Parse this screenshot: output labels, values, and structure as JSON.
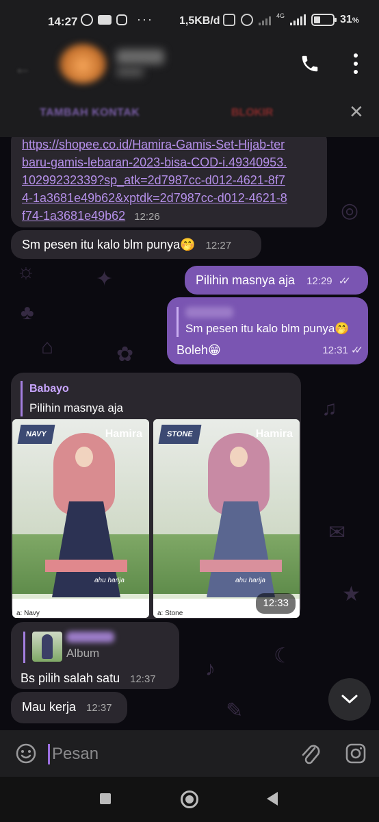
{
  "status_bar": {
    "time": "14:27",
    "more": "···",
    "net_speed": "1,5KB/d",
    "network": "4G",
    "battery": "31",
    "battery_unit": "%"
  },
  "header": {
    "add_contact": "TAMBAH KONTAK",
    "block": "BLOKIR",
    "icons": [
      "back-arrow-icon",
      "phone-icon",
      "more-vert-icon",
      "close-icon"
    ]
  },
  "messages": {
    "m1": {
      "text": "https://shopee.co.id/Hamira-Gamis-Set-Hijab-terbaru-gamis-lebaran-2023-bisa-COD-i.49340953.10299232339?sp_atk=2d7987cc-d012-4621-8f74-1a3681e49b62&xptdk=2d7987cc-d012-4621-8f74-1a3681e49b62",
      "time": "12:26"
    },
    "m2": {
      "text": "Sm pesen itu kalo blm punya🤭",
      "time": "12:27"
    },
    "m3": {
      "text": "Pilihin masnya aja",
      "time": "12:29"
    },
    "m4": {
      "quote": "Sm pesen itu kalo blm punya🤭",
      "text": "Boleh😁",
      "time": "12:31"
    },
    "m5": {
      "reply_name": "Babayo",
      "reply_text": "Pilihin masnya aja",
      "photos": [
        {
          "tag": "NAVY",
          "brand": "Hamira",
          "caption": "a: Navy",
          "watermark": "ahu harija"
        },
        {
          "tag": "STONE",
          "brand": "Hamira",
          "caption": "a: Stone",
          "watermark": "ahu harija"
        }
      ],
      "time": "12:33"
    },
    "m6": {
      "reply_label": "Album",
      "text": "Bs pilih salah satu",
      "time": "12:37"
    },
    "m7": {
      "text": "Mau kerja",
      "time": "12:37"
    }
  },
  "input": {
    "placeholder": "Pesan"
  },
  "colors": {
    "outgoing": "#7a55b2",
    "incoming": "#2a272e",
    "accent": "#b48fe8",
    "background": "#0b0a10"
  }
}
